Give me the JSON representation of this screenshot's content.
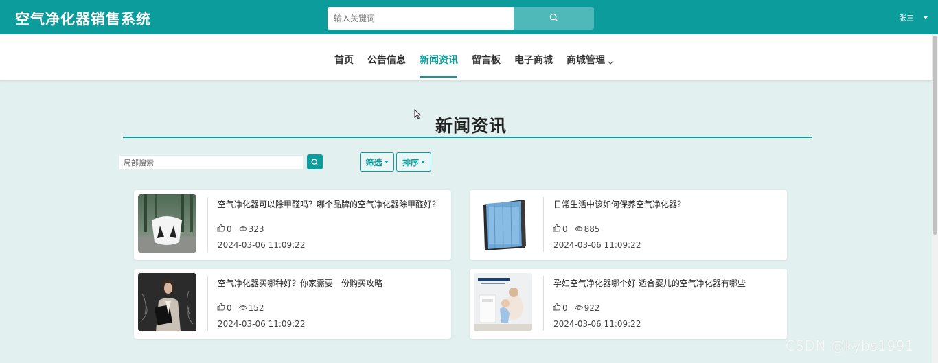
{
  "header": {
    "brand": "空气净化器销售系统",
    "search_placeholder": "输入关键词",
    "user_name": "张三"
  },
  "nav": {
    "items": [
      "首页",
      "公告信息",
      "新闻资讯",
      "留言板",
      "电子商城",
      "商城管理"
    ],
    "active_index": 2
  },
  "main": {
    "title": "新闻资讯",
    "local_search_placeholder": "局部搜索",
    "filter_label": "筛选",
    "sort_label": "排序"
  },
  "news": [
    {
      "title": "空气净化器可以除甲醛吗？哪个品牌的空气净化器除甲醛好？",
      "likes": "0",
      "views": "323",
      "date": "2024-03-06 11:09:22",
      "image": "air-purifier-forest-photo"
    },
    {
      "title": "日常生活中该如何保养空气净化器？",
      "likes": "0",
      "views": "885",
      "date": "2024-03-06 11:09:22",
      "image": "filter-cartridge-photo"
    },
    {
      "title": "空气净化器买哪种好？你家需要一份购买攻略",
      "likes": "0",
      "views": "152",
      "date": "2024-03-06 11:09:22",
      "image": "businesswoman-photo"
    },
    {
      "title": "孕妇空气净化器哪个好 适合婴儿的空气净化器有哪些",
      "likes": "0",
      "views": "922",
      "date": "2024-03-06 11:09:22",
      "image": "mother-baby-purifier-photo"
    }
  ],
  "watermark": "CSDN @kybs1991",
  "colors": {
    "accent": "#0d9c9c",
    "background": "#e3f0f0"
  }
}
